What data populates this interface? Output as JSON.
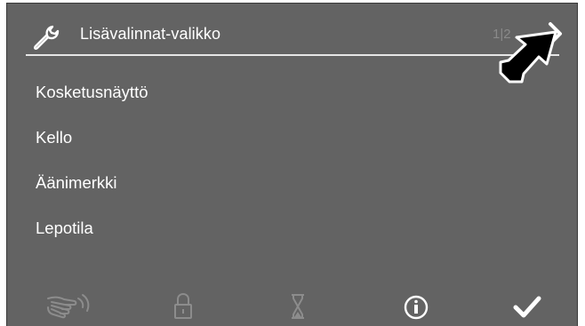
{
  "header": {
    "title": "Lisävalinnat-valikko",
    "page_indicator": "1|2",
    "icon": "wrench-icon",
    "next_icon": "chevron-right-icon"
  },
  "menu": {
    "items": [
      {
        "label": "Kosketusnäyttö"
      },
      {
        "label": "Kello"
      },
      {
        "label": "Äänimerkki"
      },
      {
        "label": "Lepotila"
      }
    ]
  },
  "bottom_bar": {
    "icons": [
      "hand-wave-icon",
      "lock-icon",
      "hourglass-icon",
      "info-icon",
      "checkmark-icon"
    ]
  },
  "colors": {
    "background": "#636363",
    "text": "#ffffff",
    "divider": "#e6e6e6",
    "muted_icon": "#8c8c8c"
  }
}
